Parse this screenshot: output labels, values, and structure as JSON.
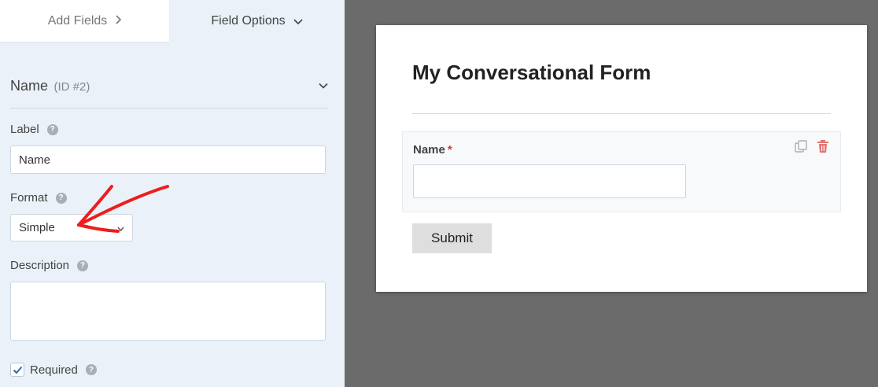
{
  "tabs": {
    "add_fields": "Add Fields",
    "field_options": "Field Options"
  },
  "field": {
    "name": "Name",
    "id": "(ID #2)"
  },
  "options": {
    "label_title": "Label",
    "label_value": "Name",
    "format_title": "Format",
    "format_value": "Simple",
    "description_title": "Description",
    "description_value": "",
    "required_label": "Required",
    "required_checked": true
  },
  "preview": {
    "form_title": "My Conversational Form",
    "field_label": "Name",
    "required_mark": "*",
    "submit_label": "Submit"
  },
  "icons": {
    "chevron_right": "chevron-right-icon",
    "chevron_down": "chevron-down-icon",
    "help": "help-icon",
    "check": "checkmark-icon",
    "duplicate": "duplicate-icon",
    "trash": "trash-icon"
  },
  "colors": {
    "panel_bg": "#eaf1f9",
    "canvas_bg": "#6b6b6b",
    "required_star": "#d63638",
    "checkbox_blue": "#2271b1",
    "annotation_red": "#ee1d1d"
  }
}
